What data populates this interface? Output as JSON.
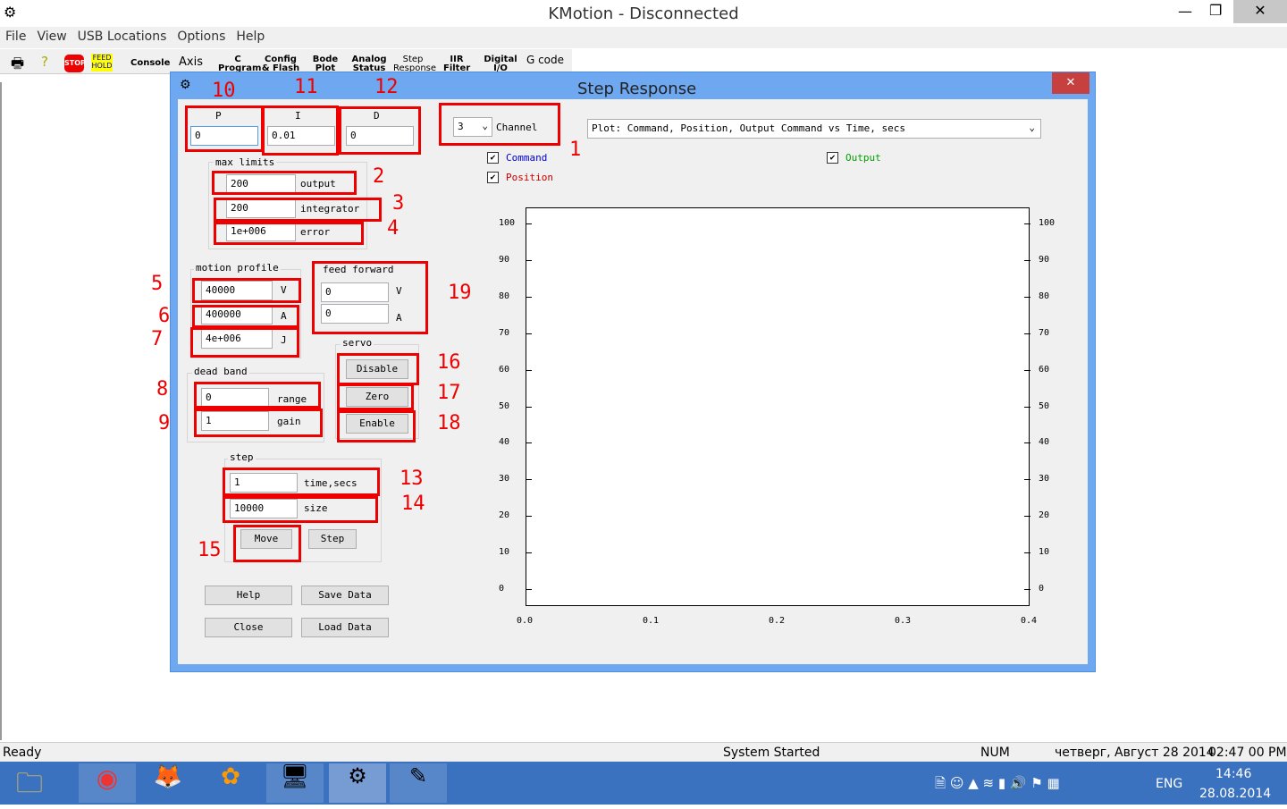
{
  "window": {
    "title": "KMotion - Disconnected",
    "minimize": "—",
    "maximize": "❐",
    "close": "✕"
  },
  "menu": [
    "File",
    "View",
    "USB Locations",
    "Options",
    "Help"
  ],
  "toolbar": {
    "stop": "STOP",
    "feedhold": "FEED HOLD",
    "items": [
      "Console",
      "Axis",
      "C Program",
      "Config & Flash",
      "Bode Plot",
      "Analog Status",
      "Step Response",
      "IIR Filter",
      "Digital I/O",
      "G code"
    ]
  },
  "dialog": {
    "title": "Step Response",
    "close": "✕",
    "pid": {
      "p_label": "P",
      "p": "0",
      "i_label": "I",
      "i": "0.01",
      "d_label": "D",
      "d": "0"
    },
    "channel": {
      "value": "3",
      "label": "Channel"
    },
    "plot_select": "Plot: Command, Position, Output Command vs Time, secs",
    "checkboxes": [
      {
        "label": "Command",
        "checked": true,
        "color": "#0000cc"
      },
      {
        "label": "Position",
        "checked": true,
        "color": "#cc0000"
      },
      {
        "label": "Output",
        "checked": true,
        "color": "#00a000"
      }
    ],
    "max_limits": {
      "title": "max limits",
      "output": "200",
      "output_label": "output",
      "integrator": "200",
      "integrator_label": "integrator",
      "error": "1e+006",
      "error_label": "error"
    },
    "motion_profile": {
      "title": "motion profile",
      "v": "40000",
      "v_label": "V",
      "a": "400000",
      "a_label": "A",
      "j": "4e+006",
      "j_label": "J"
    },
    "feed_forward": {
      "title": "feed forward",
      "v": "0",
      "v_label": "V",
      "a": "0",
      "a_label": "A"
    },
    "servo": {
      "title": "servo",
      "disable": "Disable",
      "zero": "Zero",
      "enable": "Enable"
    },
    "dead_band": {
      "title": "dead band",
      "range": "0",
      "range_label": "range",
      "gain": "1",
      "gain_label": "gain"
    },
    "step": {
      "title": "step",
      "time": "1",
      "time_label": "time,secs",
      "size": "10000",
      "size_label": "size",
      "move": "Move",
      "step": "Step"
    },
    "buttons": {
      "help": "Help",
      "save": "Save Data",
      "close": "Close",
      "load": "Load Data"
    },
    "annotations": [
      "1",
      "2",
      "3",
      "4",
      "5",
      "6",
      "7",
      "8",
      "9",
      "10",
      "11",
      "12",
      "13",
      "14",
      "15",
      "16",
      "17",
      "18",
      "19"
    ]
  },
  "chart_data": {
    "type": "line",
    "xlim": [
      0,
      0.4
    ],
    "ylim": [
      0,
      100
    ],
    "x_ticks": [
      "0.0",
      "0.1",
      "0.2",
      "0.3",
      "0.4"
    ],
    "y_ticks": [
      "0",
      "10",
      "20",
      "30",
      "40",
      "50",
      "60",
      "70",
      "80",
      "90",
      "100"
    ],
    "series": [],
    "grid": false
  },
  "status": {
    "left": "Ready",
    "mid": "System Started",
    "num": "NUM",
    "date": "четверг, Август 28 2014",
    "time": "02:47 00 PM"
  },
  "taskbar": {
    "lang": "ENG",
    "clock": "14:46",
    "date": "28.08.2014"
  }
}
